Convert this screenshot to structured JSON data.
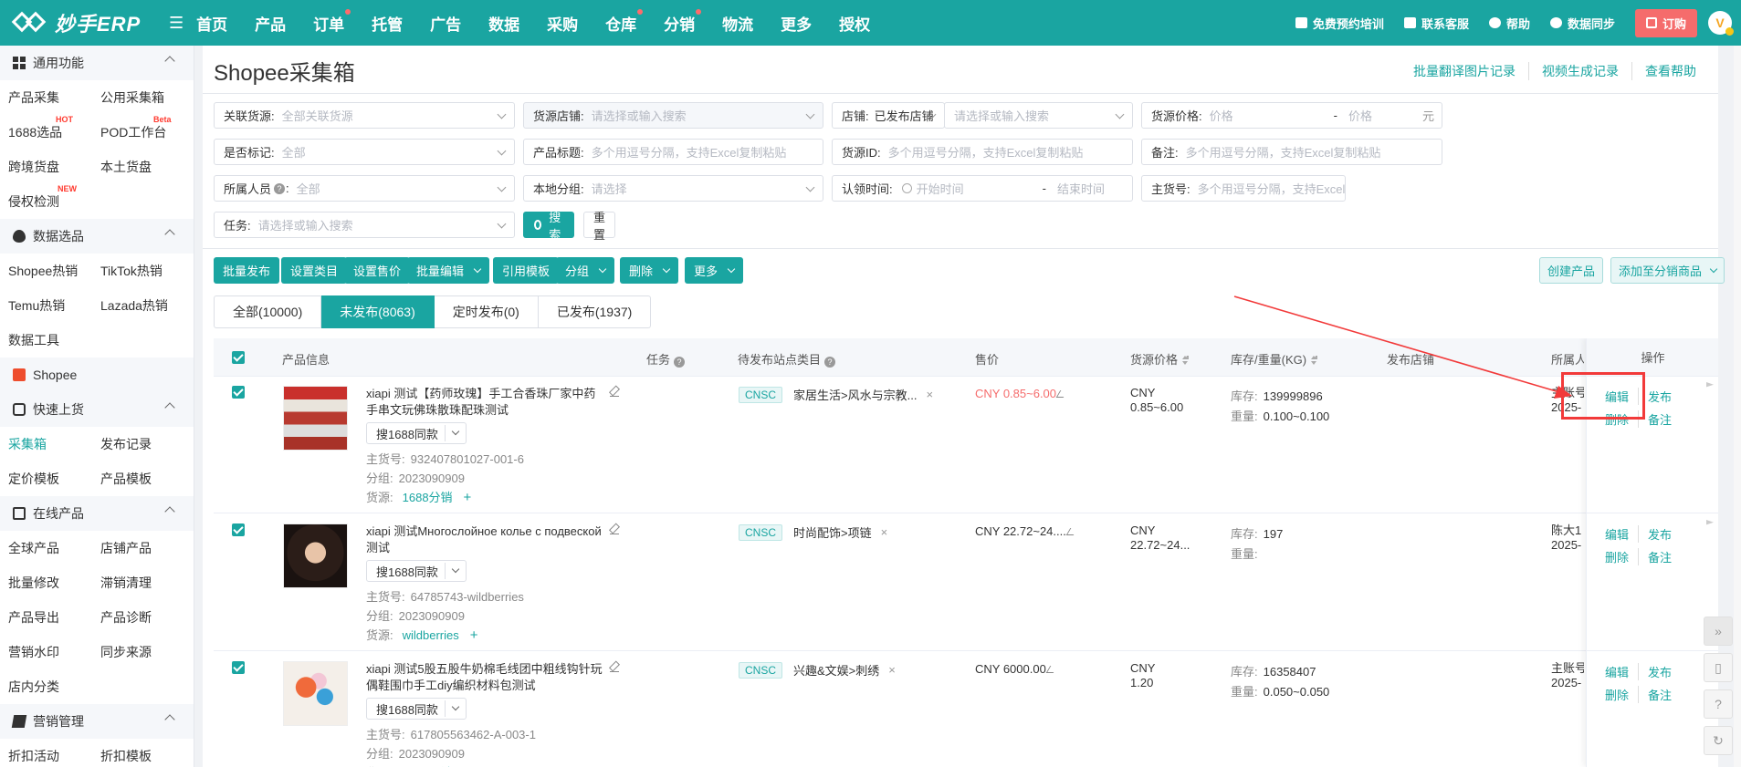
{
  "brand": {
    "name": "妙手ERP",
    "accent": "#1aa5a1"
  },
  "topnav": {
    "items": [
      {
        "label": "首页",
        "dot": false
      },
      {
        "label": "产品",
        "dot": false
      },
      {
        "label": "订单",
        "dot": true
      },
      {
        "label": "托管",
        "dot": false
      },
      {
        "label": "广告",
        "dot": false
      },
      {
        "label": "数据",
        "dot": false
      },
      {
        "label": "采购",
        "dot": false
      },
      {
        "label": "仓库",
        "dot": true
      },
      {
        "label": "分销",
        "dot": true
      },
      {
        "label": "物流",
        "dot": false
      },
      {
        "label": "更多",
        "dot": false
      },
      {
        "label": "授权",
        "dot": false
      }
    ],
    "right": {
      "training": "免费预约培训",
      "service": "联系客服",
      "help": "帮助",
      "sync": "数据同步",
      "order": "订购",
      "avatar": "V"
    }
  },
  "sidebar": {
    "sections": [
      {
        "title": "通用功能",
        "icon": "grid-icon",
        "rows": [
          [
            "产品采集",
            "公用采集箱"
          ],
          [
            "1688选品",
            "POD工作台"
          ],
          [
            "跨境货盘",
            "本土货盘"
          ],
          [
            "侵权检测",
            ""
          ]
        ]
      },
      {
        "title": "数据选品",
        "icon": "fire-icon",
        "rows": [
          [
            "Shopee热销",
            "TikTok热销"
          ],
          [
            "Temu热销",
            "Lazada热销"
          ],
          [
            "数据工具",
            ""
          ]
        ]
      },
      {
        "title": "Shopee",
        "icon": "shopee-bag-icon",
        "rows": []
      },
      {
        "title": "快速上货",
        "icon": "lock-icon",
        "rows": [
          [
            "采集箱",
            "发布记录"
          ],
          [
            "定价模板",
            "产品模板"
          ]
        ]
      },
      {
        "title": "在线产品",
        "icon": "monitor-icon",
        "rows": [
          [
            "全球产品",
            "店铺产品"
          ],
          [
            "批量修改",
            "滞销清理"
          ],
          [
            "产品导出",
            "产品诊断"
          ],
          [
            "营销水印",
            "同步来源"
          ],
          [
            "店内分类",
            ""
          ]
        ]
      },
      {
        "title": "营销管理",
        "icon": "ticket-icon",
        "rows": [
          [
            "折扣活动",
            "折扣模板"
          ]
        ]
      }
    ],
    "badges": {
      "hot": "HOT",
      "beta": "Beta",
      "new": "NEW"
    },
    "active": "采集箱"
  },
  "page": {
    "title": "Shopee采集箱",
    "links": [
      "批量翻译图片记录",
      "视频生成记录",
      "查看帮助"
    ]
  },
  "filters": {
    "related_source": {
      "label": "关联货源:",
      "placeholder": "全部关联货源"
    },
    "source_shop": {
      "label": "货源店铺:",
      "placeholder": "请选择或输入搜索"
    },
    "shop": {
      "label": "店铺:",
      "value": "已发布店铺",
      "placeholder": "请选择或输入搜索"
    },
    "source_price": {
      "label": "货源价格:",
      "min_ph": "价格",
      "dash": "-",
      "max_ph": "价格",
      "unit": "元"
    },
    "marked": {
      "label": "是否标记:",
      "placeholder": "全部"
    },
    "title": {
      "label": "产品标题:",
      "placeholder": "多个用逗号分隔，支持Excel复制粘贴"
    },
    "source_id": {
      "label": "货源ID:",
      "placeholder": "多个用逗号分隔，支持Excel复制粘贴"
    },
    "remark": {
      "label": "备注:",
      "placeholder": "多个用逗号分隔，支持Excel复制粘贴"
    },
    "owner": {
      "label": "所属人员",
      "placeholder": "全部"
    },
    "local_group": {
      "label": "本地分组:",
      "placeholder": "请选择"
    },
    "claim_time": {
      "label": "认领时间:",
      "start_ph": "开始时间",
      "dash": "-",
      "end_ph": "结束时间"
    },
    "sku": {
      "label": "主货号:",
      "placeholder": "多个用逗号分隔，支持Excel复"
    },
    "task": {
      "label": "任务:",
      "placeholder": "请选择或输入搜索"
    },
    "search_btn": "搜索",
    "reset_btn": "重置"
  },
  "actions": {
    "batch_publish": "批量发布",
    "set_category": "设置类目",
    "set_price": "设置售价",
    "batch_edit": "批量编辑",
    "use_template": "引用模板",
    "group": "分组",
    "delete": "删除",
    "more": "更多",
    "create_product": "创建产品",
    "add_distribution": "添加至分销商品"
  },
  "tabs": [
    {
      "label": "全部(10000)",
      "active": false
    },
    {
      "label": "未发布(8063)",
      "active": true
    },
    {
      "label": "定时发布(0)",
      "active": false
    },
    {
      "label": "已发布(1937)",
      "active": false
    }
  ],
  "table": {
    "headers": {
      "product": "产品信息",
      "task": "任务",
      "category": "待发布站点类目",
      "price": "售价",
      "source_price": "货源价格",
      "stock": "库存/重量(KG)",
      "shop": "发布店铺",
      "owner": "所属人",
      "ops": "操作"
    },
    "same_btn": "搜1688同款",
    "sku_label": "主货号:",
    "group_label": "分组:",
    "source_label": "货源:",
    "stock_label": "库存:",
    "weight_label": "重量:",
    "op_edit": "编辑",
    "op_publish": "发布",
    "op_delete": "删除",
    "op_remark": "备注",
    "rows": [
      {
        "title": "xiapi 测试【药师玫瑰】手工合香珠厂家中药手串文玩佛珠散珠配珠测试",
        "sku": "932407801027-001-6",
        "group": "2023090909",
        "source": "1688分销",
        "site": "CNSC",
        "category": "家居生活>风水与宗教...",
        "price": "CNY  0.85~6.00",
        "price_red": true,
        "src_currency": "CNY",
        "src_price": "0.85~6.00",
        "stock": "139999896",
        "weight": "0.100~0.100",
        "owner": "主账号",
        "owner_date": "2025-"
      },
      {
        "title": "xiapi 测试Многослойное колье с подвеской测试",
        "sku": "64785743-wildberries",
        "group": "2023090909",
        "source": "wildberries",
        "site": "CNSC",
        "category": "时尚配饰>项链",
        "price": "CNY  22.72~24....",
        "price_red": false,
        "src_currency": "CNY",
        "src_price": "22.72~24...",
        "stock": "197",
        "weight": "",
        "owner": "陈大1",
        "owner_date": "2025-"
      },
      {
        "title": "xiapi 测试5股五股牛奶棉毛线团中粗线钩针玩偶鞋围巾手工diy编织材料包测试",
        "sku": "617805563462-A-003-1",
        "group": "2023090909",
        "source": "1688分销",
        "site": "CNSC",
        "category": "兴趣&文娱>刺绣",
        "price": "CNY  6000.00",
        "price_red": false,
        "src_currency": "CNY",
        "src_price": "1.20",
        "stock": "16358407",
        "weight": "0.050~0.050",
        "owner": "主账号",
        "owner_date": "2025-"
      }
    ]
  },
  "colors": {
    "highlight": "#f23a3a",
    "price_red": "#f56c6c"
  }
}
